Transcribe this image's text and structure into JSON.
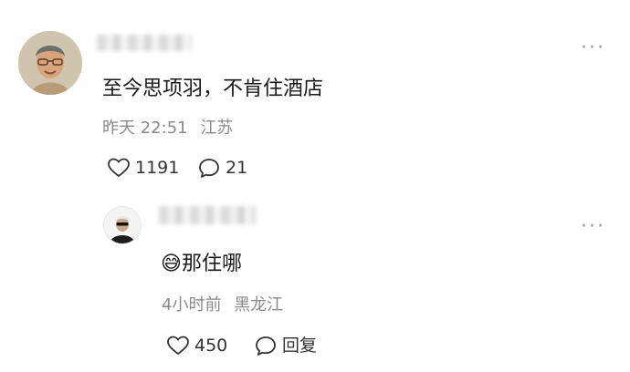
{
  "comments": [
    {
      "text": "至今思项羽，不肯住酒店",
      "time": "昨天 22:51",
      "location": "江苏",
      "likes": "1191",
      "replies": "21"
    }
  ],
  "reply": {
    "text": "那住哪",
    "emoji": "😅",
    "time": "4小时前",
    "location": "黑龙江",
    "likes": "450",
    "reply_label": "回复"
  },
  "more_glyph": "···"
}
